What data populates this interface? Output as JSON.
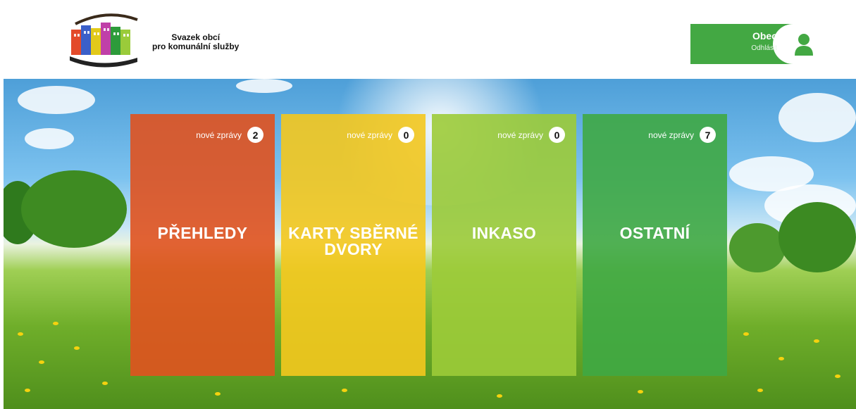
{
  "org": {
    "line1": "Svazek obcí",
    "line2": "pro komunální služby"
  },
  "user": {
    "name": "Obec",
    "logout": "Odhlásit"
  },
  "tiles": [
    {
      "title": "PŘEHLEDY",
      "msg_label": "nové zprávy",
      "count": "2",
      "color": "#e0521f"
    },
    {
      "title": "KARTY SBĚRNÉ DVORY",
      "msg_label": "nové zprávy",
      "count": "0",
      "color": "#f4c81e"
    },
    {
      "title": "INKASO",
      "msg_label": "nové zprávy",
      "count": "0",
      "color": "#9ccb38"
    },
    {
      "title": "OSTATNÍ",
      "msg_label": "nové zprávy",
      "count": "7",
      "color": "#3fa844"
    }
  ],
  "colors": {
    "header_accent": "#43a843",
    "user_icon": "#43a843"
  }
}
